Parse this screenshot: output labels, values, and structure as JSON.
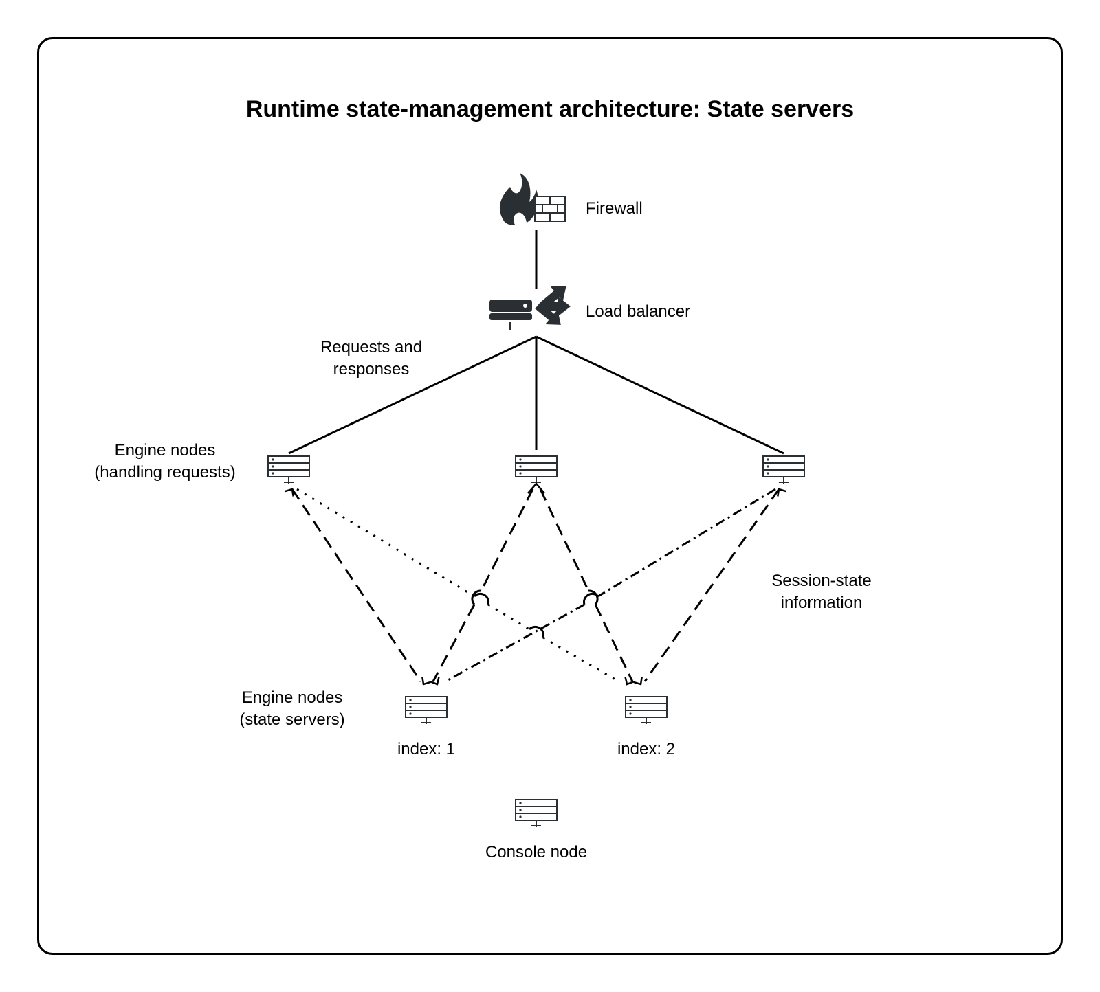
{
  "title": "Runtime state-management architecture: State servers",
  "nodes": {
    "firewall": {
      "label": "Firewall"
    },
    "load_balancer": {
      "label": "Load balancer"
    },
    "requests_label": "Requests and\nresponses",
    "engine_nodes_handling_label": "Engine nodes\n(handling requests)",
    "session_state_label": "Session-state\ninformation",
    "engine_nodes_state_label": "Engine nodes\n(state servers)",
    "state_server_1_index": "index: 1",
    "state_server_2_index": "index: 2",
    "console_node_label": "Console node"
  }
}
